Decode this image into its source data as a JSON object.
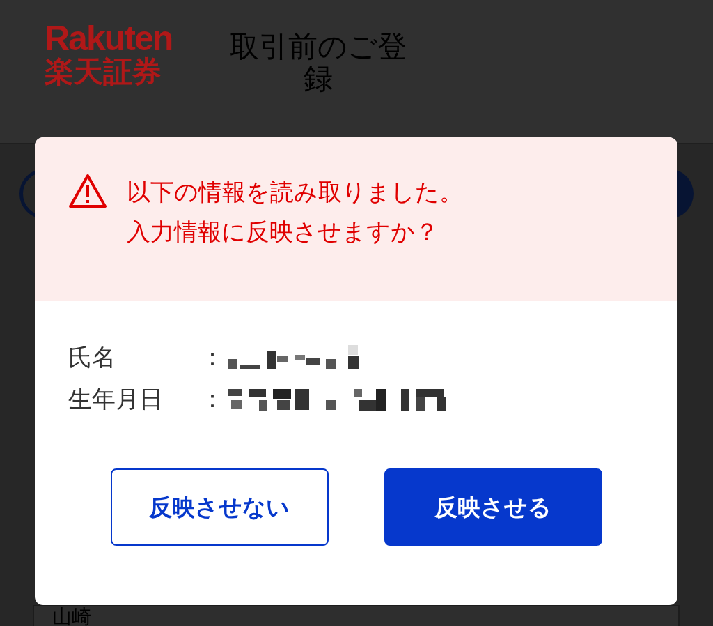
{
  "header": {
    "logo": {
      "wordmark": "Rakuten",
      "name": "楽天証券"
    },
    "title": "取引前のご登録"
  },
  "background_field": {
    "value": "山崎"
  },
  "dialog": {
    "message": [
      "以下の情報を読み取りました。",
      "入力情報に反映させますか？"
    ],
    "fields": [
      {
        "label": "氏名",
        "separator": "："
      },
      {
        "label": "生年月日",
        "separator": "："
      }
    ],
    "buttons": [
      {
        "label": "反映させない",
        "kind": "outline"
      },
      {
        "label": "反映させる",
        "kind": "primary"
      }
    ]
  }
}
